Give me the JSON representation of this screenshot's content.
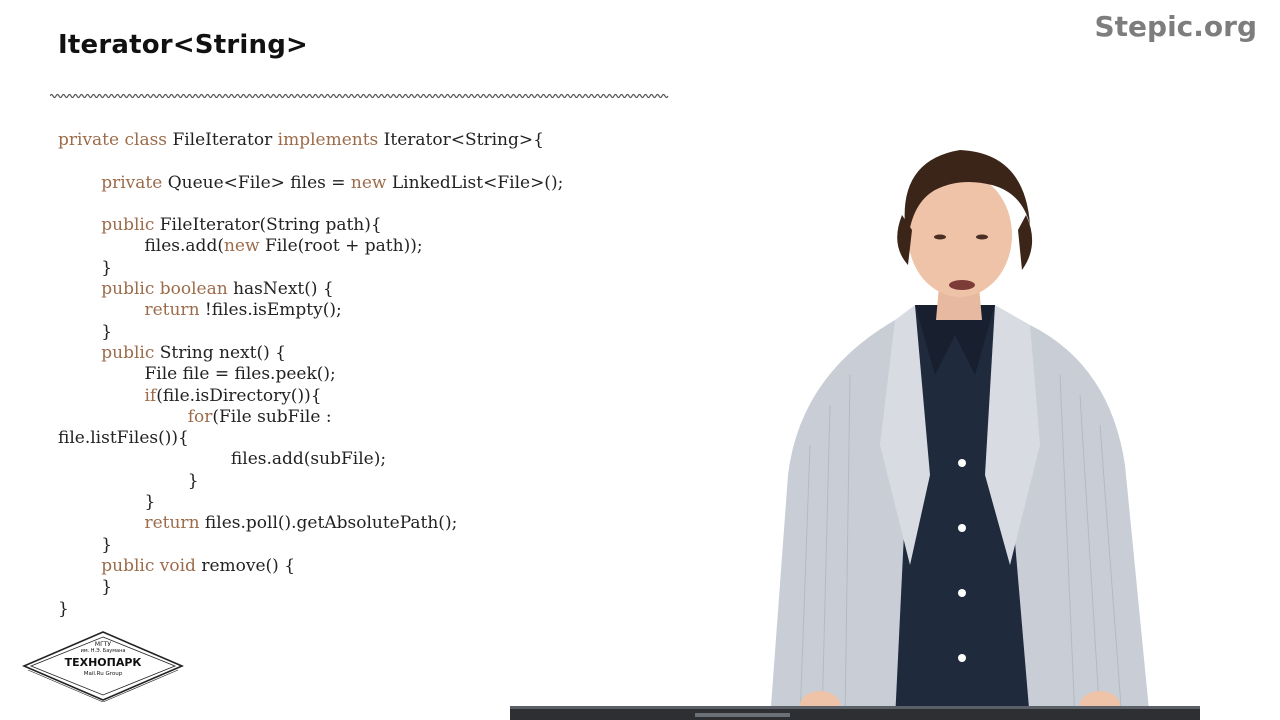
{
  "header": {
    "title": "Iterator<String>",
    "brand": "Stepic.org"
  },
  "code": {
    "lines": [
      [
        {
          "t": "private ",
          "k": true
        },
        {
          "t": "class ",
          "k": true
        },
        {
          "t": "FileIterator ",
          "k": false
        },
        {
          "t": "implements ",
          "k": true
        },
        {
          "t": "Iterator<String>{",
          "k": false
        }
      ],
      [],
      [
        {
          "t": "        ",
          "k": false
        },
        {
          "t": "private ",
          "k": true
        },
        {
          "t": "Queue<File> files = ",
          "k": false
        },
        {
          "t": "new ",
          "k": true
        },
        {
          "t": "LinkedList<File>();",
          "k": false
        }
      ],
      [],
      [
        {
          "t": "        ",
          "k": false
        },
        {
          "t": "public ",
          "k": true
        },
        {
          "t": "FileIterator(String path){",
          "k": false
        }
      ],
      [
        {
          "t": "                files.add(",
          "k": false
        },
        {
          "t": "new ",
          "k": true
        },
        {
          "t": "File(root + path));",
          "k": false
        }
      ],
      [
        {
          "t": "        }",
          "k": false
        }
      ],
      [
        {
          "t": "        ",
          "k": false
        },
        {
          "t": "public ",
          "k": true
        },
        {
          "t": "boolean ",
          "k": true
        },
        {
          "t": "hasNext() {",
          "k": false
        }
      ],
      [
        {
          "t": "                ",
          "k": false
        },
        {
          "t": "return ",
          "k": true
        },
        {
          "t": "!files.isEmpty();",
          "k": false
        }
      ],
      [
        {
          "t": "        }",
          "k": false
        }
      ],
      [
        {
          "t": "        ",
          "k": false
        },
        {
          "t": "public ",
          "k": true
        },
        {
          "t": "String next() {",
          "k": false
        }
      ],
      [
        {
          "t": "                File file = files.peek();",
          "k": false
        }
      ],
      [
        {
          "t": "                ",
          "k": false
        },
        {
          "t": "if",
          "k": true
        },
        {
          "t": "(file.isDirectory()){",
          "k": false
        }
      ],
      [
        {
          "t": "                        ",
          "k": false
        },
        {
          "t": "for",
          "k": true
        },
        {
          "t": "(File subFile :",
          "k": false
        }
      ],
      [
        {
          "t": "file.listFiles()){",
          "k": false
        }
      ],
      [
        {
          "t": "                                files.add(subFile);",
          "k": false
        }
      ],
      [
        {
          "t": "                        }",
          "k": false
        }
      ],
      [
        {
          "t": "                }",
          "k": false
        }
      ],
      [
        {
          "t": "                ",
          "k": false
        },
        {
          "t": "return ",
          "k": true
        },
        {
          "t": "files.poll().getAbsolutePath();",
          "k": false
        }
      ],
      [
        {
          "t": "        }",
          "k": false
        }
      ],
      [
        {
          "t": "        ",
          "k": false
        },
        {
          "t": "public ",
          "k": true
        },
        {
          "t": "void ",
          "k": true
        },
        {
          "t": "remove() {",
          "k": false
        }
      ],
      [
        {
          "t": "        }",
          "k": false
        }
      ],
      [
        {
          "t": "}",
          "k": false
        }
      ]
    ]
  },
  "logo": {
    "line1": "МГТУ",
    "line2": "им. Н.Э. Баумана",
    "line3": "ТЕХНОПАРК",
    "line4": "Mail.Ru Group"
  }
}
